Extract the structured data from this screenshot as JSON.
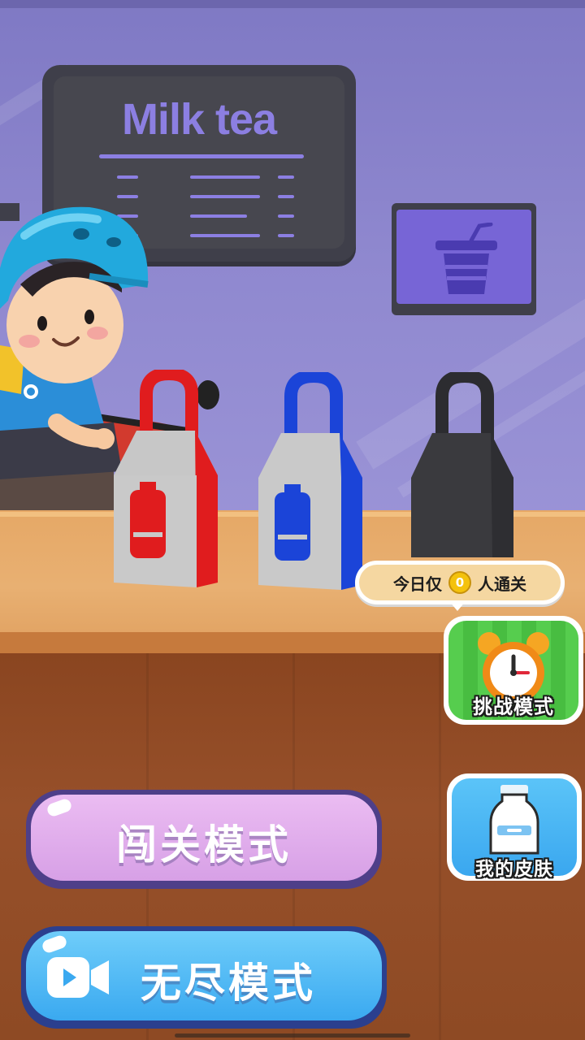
{
  "menu_board": {
    "title": "Milk tea"
  },
  "bags": [
    {
      "color": "red",
      "hex": "#e01c1e"
    },
    {
      "color": "blue",
      "hex": "#1b44d8"
    },
    {
      "color": "black",
      "hex": "#3a3a3e"
    }
  ],
  "challenge_tip": {
    "prefix": "今日仅",
    "count": "0",
    "suffix": "人通关"
  },
  "challenge_button": {
    "label": "挑战模式",
    "icon": "alarm-clock-icon"
  },
  "skin_button": {
    "label": "我的皮肤",
    "icon": "milk-bottle-icon"
  },
  "level_mode_button": {
    "label": "闯关模式"
  },
  "endless_mode_button": {
    "label": "无尽模式",
    "icon": "video-camera-icon"
  },
  "colors": {
    "purple_button": "#d9a8e8",
    "blue_button": "#4fb4f5",
    "green_button": "#4fc94a"
  }
}
